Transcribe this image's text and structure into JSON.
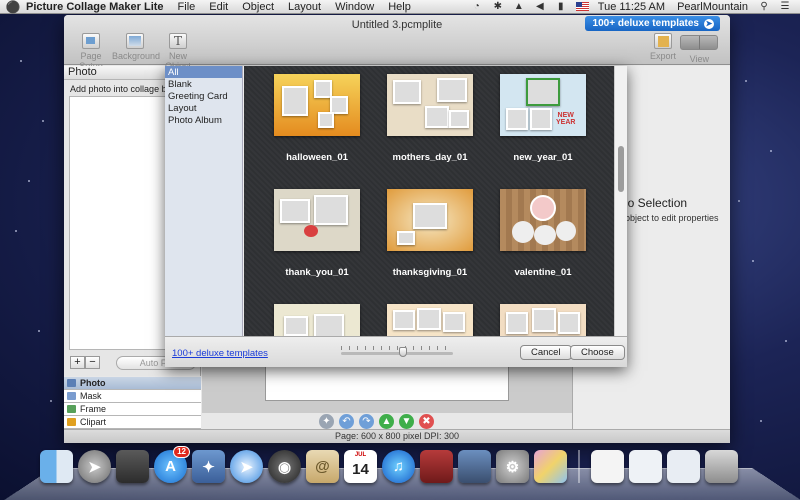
{
  "menubar": {
    "app_name": "Picture Collage Maker Lite",
    "menus": [
      "File",
      "Edit",
      "Object",
      "Layout",
      "Window",
      "Help"
    ],
    "clock": "Tue 11:25 AM",
    "user": "PearlMountain"
  },
  "window": {
    "title": "Untitled 3.pcmplite",
    "deluxe_button": "100+ deluxe templates",
    "toolbar": {
      "page_setup": "Page Setup",
      "background": "Background",
      "new_object": "New Object",
      "export": "Export",
      "view": "View"
    },
    "left_panel": {
      "header": "Photo",
      "hint": "Add photo into collage by drag",
      "plus": "+",
      "minus": "−",
      "auto_fill": "Auto Fill"
    },
    "left_tabs": [
      {
        "label": "Photo",
        "color": "#5b7fb5"
      },
      {
        "label": "Mask",
        "color": "#7a9ccf"
      },
      {
        "label": "Frame",
        "color": "#57a05a"
      },
      {
        "label": "Clipart",
        "color": "#e0a020"
      }
    ],
    "properties": {
      "title": "lo Selection",
      "subtitle": "object to edit properties"
    },
    "status": "Page: 600 x 800 pixel DPI: 300"
  },
  "template_sheet": {
    "categories": [
      "All",
      "Blank",
      "Greeting Card",
      "Layout",
      "Photo Album"
    ],
    "selected_category": "All",
    "templates": [
      {
        "name": "halloween_01",
        "bg": "#f3c64a"
      },
      {
        "name": "mothers_day_01",
        "bg": "#e9ddc6"
      },
      {
        "name": "new_year_01",
        "bg": "#cfe3ef"
      },
      {
        "name": "thank_you_01",
        "bg": "#dcd7c8"
      },
      {
        "name": "thanksgiving_01",
        "bg": "#f3e2b6"
      },
      {
        "name": "valentine_01",
        "bg": "#b48a5e"
      },
      {
        "name": "",
        "bg": "#ece8d2"
      },
      {
        "name": "",
        "bg": "#f6e4c7"
      },
      {
        "name": "",
        "bg": "#f2ddc2"
      }
    ],
    "thumbnail_size_fraction": 0.55,
    "deluxe_link": "100+ deluxe templates",
    "cancel": "Cancel",
    "choose": "Choose"
  },
  "dock": {
    "app_store_badge": "12",
    "calendar_month": "JUL",
    "calendar_day": "14"
  }
}
